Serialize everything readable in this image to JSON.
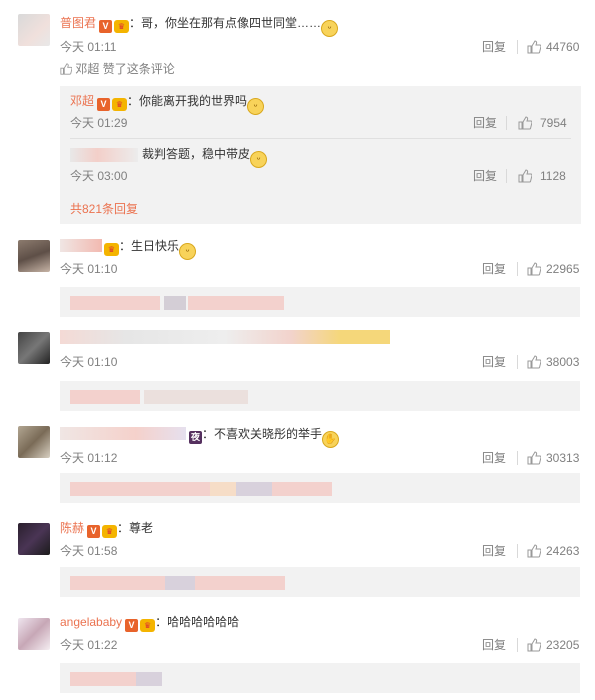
{
  "labels": {
    "reply": "回复",
    "liked_suffix": "赞了这条评论",
    "today_prefix": "今天"
  },
  "top_comment": {
    "name": "普图君",
    "text": "：哥，你坐在那有点像四世同堂……",
    "time": "今天 01:11",
    "likes": "44760",
    "liker": "邓超",
    "sub_replies": [
      {
        "name": "邓超",
        "text": "：你能离开我的世界吗",
        "time": "今天 01:29",
        "likes": "7954"
      },
      {
        "name": "",
        "text": "裁判答题，稳中带皮",
        "time": "今天 03:00",
        "likes": "1128"
      }
    ],
    "more_link": "共821条回复"
  },
  "comments": [
    {
      "name": "",
      "text": "：生日快乐",
      "time": "今天 01:10",
      "likes": "22965"
    },
    {
      "name": "",
      "text": "",
      "time": "今天 01:10",
      "likes": "38003"
    },
    {
      "name": "",
      "text": "：不喜欢关晓彤的举手",
      "time": "今天 01:12",
      "likes": "30313"
    },
    {
      "name": "陈赫",
      "text": "：尊老",
      "time": "今天 01:58",
      "likes": "24263"
    },
    {
      "name": "angelababy",
      "text": "：哈哈哈哈哈哈",
      "time": "今天 01:22",
      "likes": "23205"
    }
  ],
  "icons": {
    "thumb": "thumbs-up-icon",
    "verified": "verified-v-icon",
    "vip": "vip-crown-icon",
    "emoji": "smiley-emoji-icon"
  },
  "colors": {
    "link": "#eb7350",
    "muted": "#808080",
    "sub_bg": "#f2f2f2",
    "blur": "#f3c6c0"
  }
}
